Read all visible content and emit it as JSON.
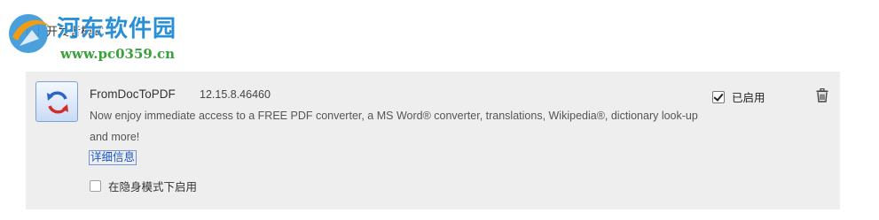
{
  "watermark": {
    "title": "河东软件园",
    "url": "www.pc0359.cn"
  },
  "developer_mode": {
    "label": "开发者模式",
    "checked": false
  },
  "extension": {
    "name": "FromDocToPDF",
    "version": "12.15.8.46460",
    "description": "Now enjoy immediate access to a FREE PDF converter, a MS Word® converter, translations, Wikipedia®, dictionary look-up and more!",
    "details_link": "详细信息",
    "incognito_label": "在隐身模式下启用",
    "incognito_checked": false,
    "enabled_label": "已启用",
    "enabled_checked": true,
    "icon": "pdf-convert-icon",
    "remove_icon": "trash-icon"
  },
  "colors": {
    "card_background": "#eeeeee",
    "link": "#1a55c6",
    "watermark_blue": "#2b8fd6",
    "watermark_green": "#3aa03a"
  }
}
